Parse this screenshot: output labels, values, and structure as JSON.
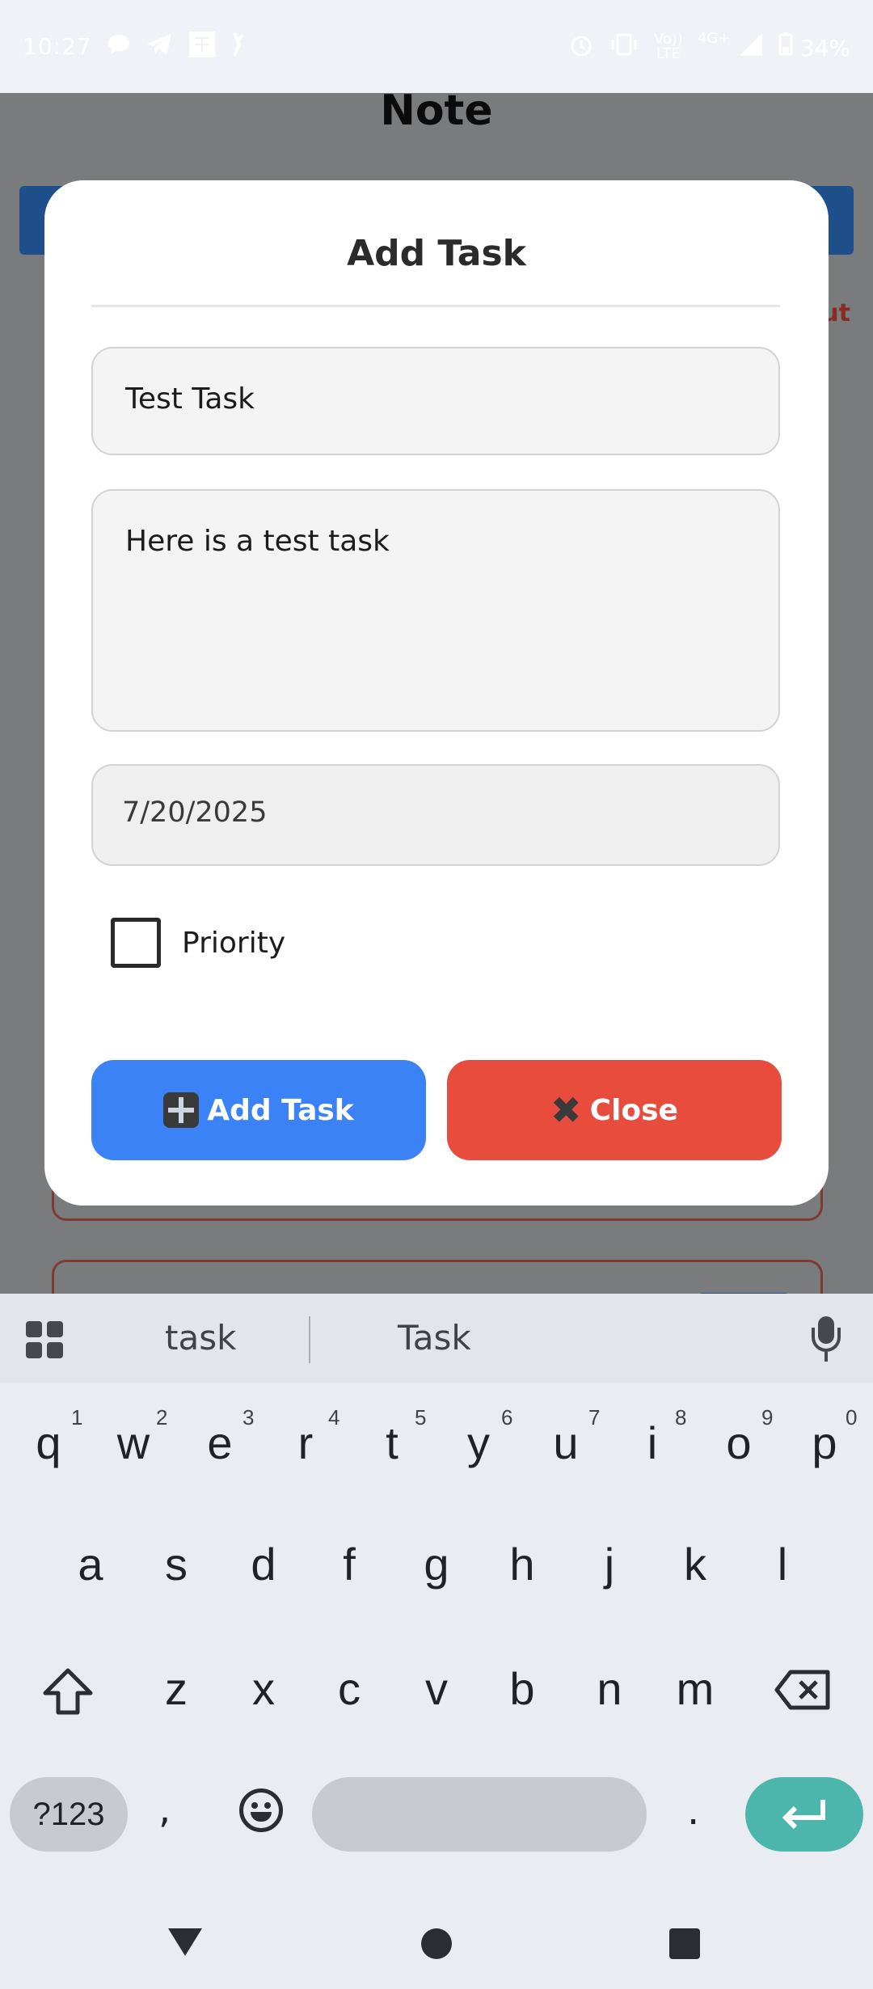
{
  "status_bar": {
    "time": "10:27",
    "network_label_top": "Vo))",
    "network_label_bottom": "LTE",
    "network_type": "4G+",
    "battery": "34%"
  },
  "background_page": {
    "title": "Note",
    "logout_label_partial": "ut"
  },
  "modal": {
    "title": "Add Task",
    "title_field_value": "Test Task",
    "description_field_value": "Here is a test task",
    "date_field_value": "7/20/2025",
    "priority_label": "Priority",
    "priority_checked": false,
    "add_button_label": "Add Task",
    "close_button_label": "Close",
    "add_button_color": "#3b82f6",
    "close_button_color": "#e74c3c"
  },
  "keyboard": {
    "suggestions": [
      "task",
      "Task"
    ],
    "row1": [
      "q",
      "w",
      "e",
      "r",
      "t",
      "y",
      "u",
      "i",
      "o",
      "p"
    ],
    "row1_numbers": [
      "1",
      "2",
      "3",
      "4",
      "5",
      "6",
      "7",
      "8",
      "9",
      "0"
    ],
    "row2": [
      "a",
      "s",
      "d",
      "f",
      "g",
      "h",
      "j",
      "k",
      "l"
    ],
    "row3": [
      "z",
      "x",
      "c",
      "v",
      "b",
      "n",
      "m"
    ],
    "symbols_key": "?123",
    "comma": ",",
    "period": ".",
    "enter_color": "#4db6ac"
  }
}
